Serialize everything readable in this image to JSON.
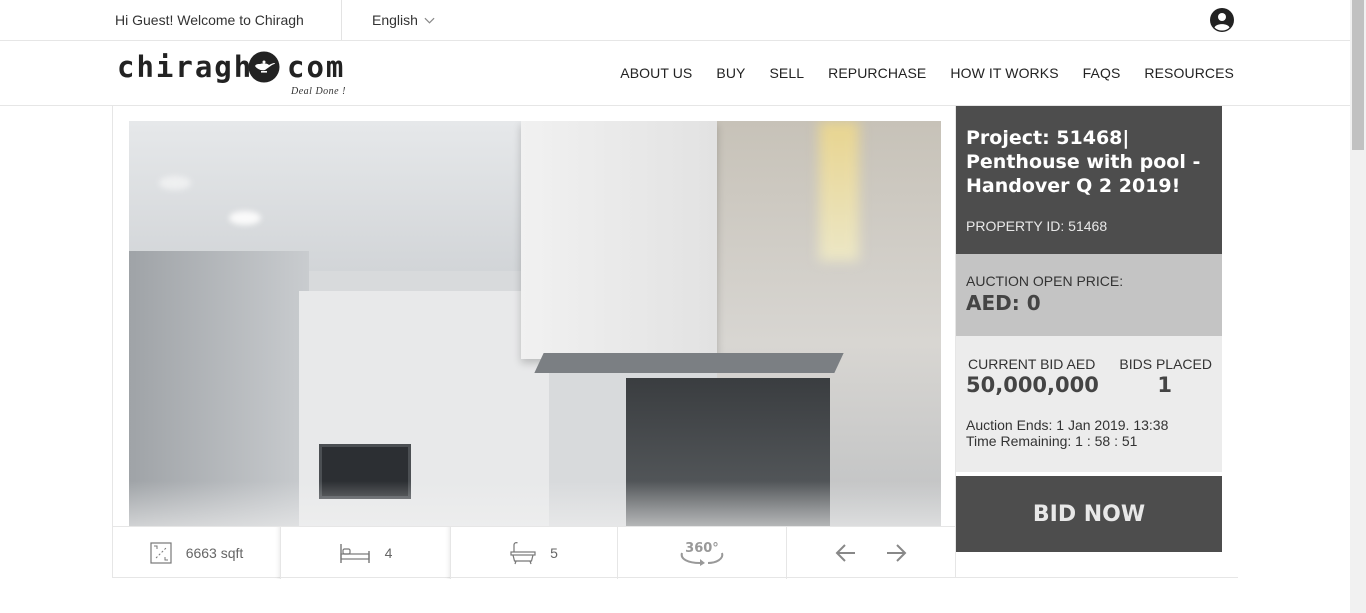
{
  "topbar": {
    "welcome": "Hi Guest! Welcome to Chiragh",
    "language": "English"
  },
  "logo": {
    "word_left": "chiragh",
    "word_right": "com",
    "tagline": "Deal Done !"
  },
  "nav": {
    "items": [
      "ABOUT US",
      "BUY",
      "SELL",
      "REPURCHASE",
      "HOW IT WORKS",
      "FAQS",
      "RESOURCES"
    ]
  },
  "property": {
    "title": "Project: 51468| Penthouse with pool - Handover Q 2 2019!",
    "property_id": "PROPERTY ID: 51468",
    "open_price_label": "AUCTION OPEN PRICE:",
    "open_price_value": "AED: 0",
    "current_bid_label": "CURRENT BID AED",
    "current_bid_value": "50,000,000",
    "bids_placed_label": "BIDS PLACED",
    "bids_placed_value": "1",
    "auction_ends": "Auction Ends: 1 Jan 2019. 13:38",
    "time_remaining": "Time Remaining: 1 : 58 : 51",
    "bid_button": "BID NOW"
  },
  "specs": {
    "area": "6663 sqft",
    "bedrooms": "4",
    "bathrooms": "5",
    "view360_label": "360°"
  },
  "icons": [
    "user-icon",
    "chevron-down-icon",
    "lamp-logo-icon",
    "area-icon",
    "bed-icon",
    "bath-icon",
    "view-360-icon",
    "arrow-left-icon",
    "arrow-right-icon"
  ],
  "colors": {
    "dark_panel": "#4d4d4d",
    "mid_panel": "#c4c4c4",
    "light_panel": "#ececec"
  }
}
